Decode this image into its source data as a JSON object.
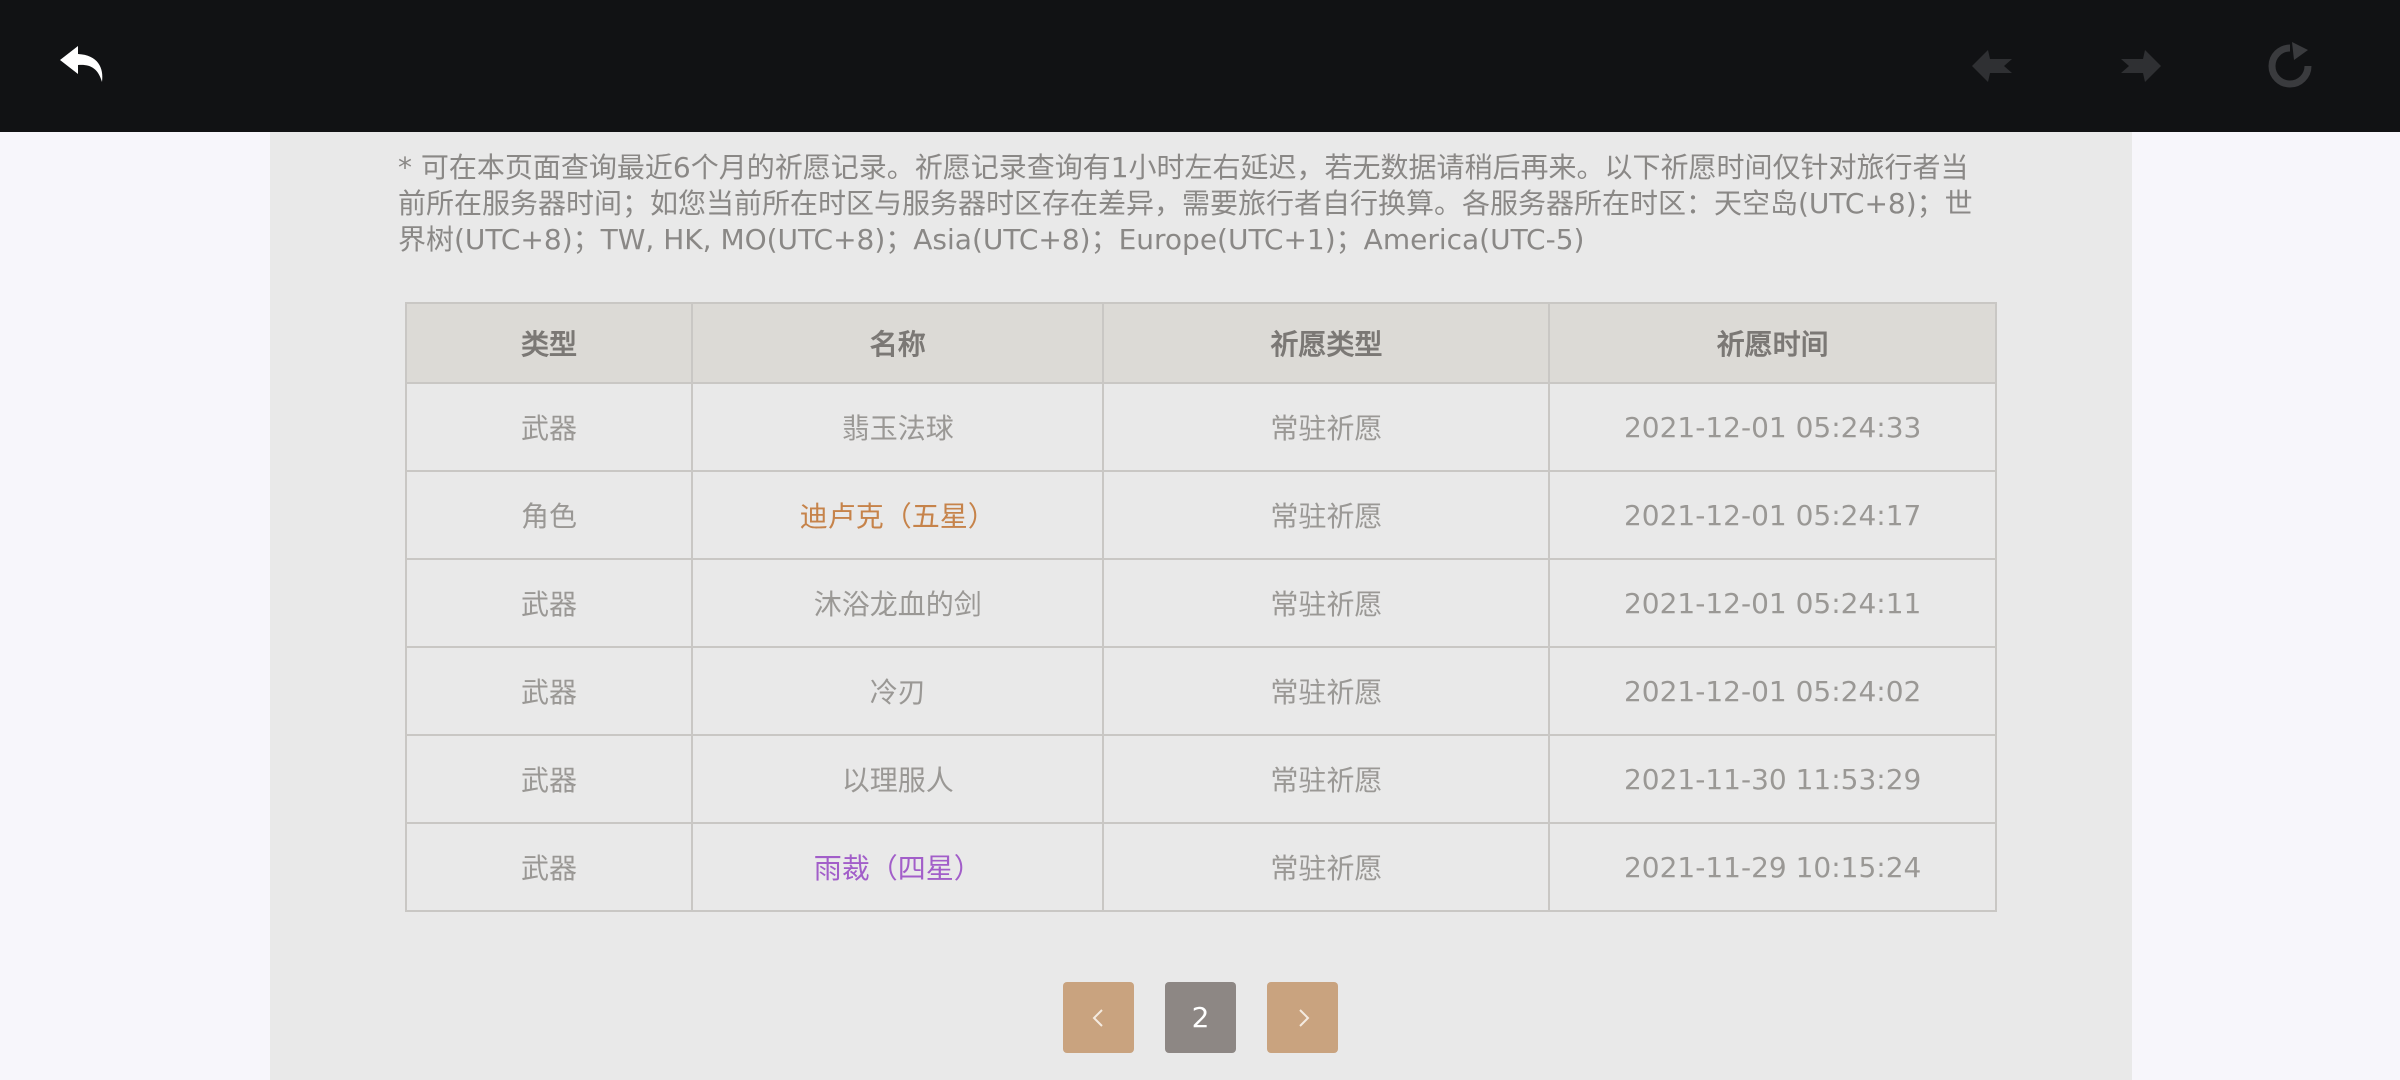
{
  "colors": {
    "topbar": "#111214",
    "five_star": "#c6834a",
    "four_star": "#a25ec9",
    "pager_arrow": "#c9a37f",
    "pager_current": "#8d8784"
  },
  "toolbar": {
    "back_icon": "undo-arrow-icon",
    "prev_icon": "arrow-left-diamond-icon",
    "next_icon": "arrow-right-diamond-icon",
    "refresh_icon": "refresh-icon"
  },
  "notice": "* 可在本页面查询最近6个月的祈愿记录。祈愿记录查询有1小时左右延迟，若无数据请稍后再来。以下祈愿时间仅针对旅行者当前所在服务器时间；如您当前所在时区与服务器时区存在差异，需要旅行者自行换算。各服务器所在时区：天空岛(UTC+8)；世界树(UTC+8)；TW, HK, MO(UTC+8)；Asia(UTC+8)；Europe(UTC+1)；America(UTC-5)",
  "table": {
    "headers": [
      "类型",
      "名称",
      "祈愿类型",
      "祈愿时间"
    ],
    "rows": [
      {
        "type": "武器",
        "name": "翡玉法球",
        "wish_type": "常驻祈愿",
        "time": "2021-12-01 05:24:33"
      },
      {
        "type": "角色",
        "name": "迪卢克（五星）",
        "wish_type": "常驻祈愿",
        "time": "2021-12-01 05:24:17"
      },
      {
        "type": "武器",
        "name": "沐浴龙血的剑",
        "wish_type": "常驻祈愿",
        "time": "2021-12-01 05:24:11"
      },
      {
        "type": "武器",
        "name": "冷刃",
        "wish_type": "常驻祈愿",
        "time": "2021-12-01 05:24:02"
      },
      {
        "type": "武器",
        "name": "以理服人",
        "wish_type": "常驻祈愿",
        "time": "2021-11-30 11:53:29"
      },
      {
        "type": "武器",
        "name": "雨裁（四星）",
        "wish_type": "常驻祈愿",
        "time": "2021-11-29 10:15:24"
      }
    ]
  },
  "pager": {
    "prev_label": "‹",
    "current_page": "2",
    "next_label": "›"
  }
}
